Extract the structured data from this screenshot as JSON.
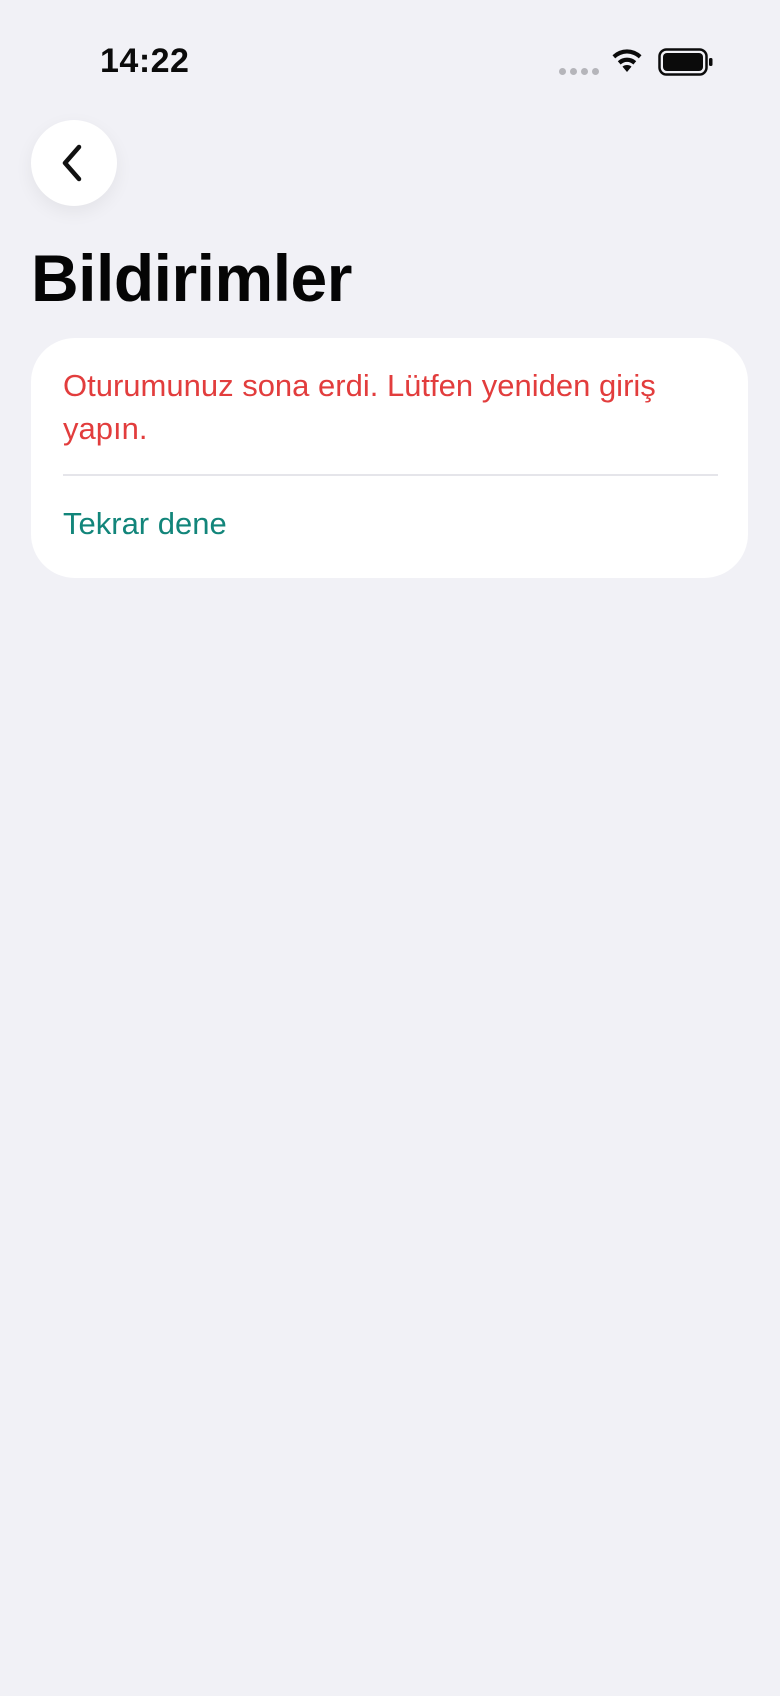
{
  "status_bar": {
    "time": "14:22"
  },
  "header": {
    "back_icon": "chevron-left-icon",
    "title": "Bildirimler"
  },
  "error_card": {
    "message": "Oturumunuz sona erdi. Lütfen yeniden giriş yapın.",
    "retry_label": "Tekrar dene"
  },
  "colors": {
    "background": "#f1f1f6",
    "error_text": "#e23d3d",
    "action_text": "#12857a"
  }
}
